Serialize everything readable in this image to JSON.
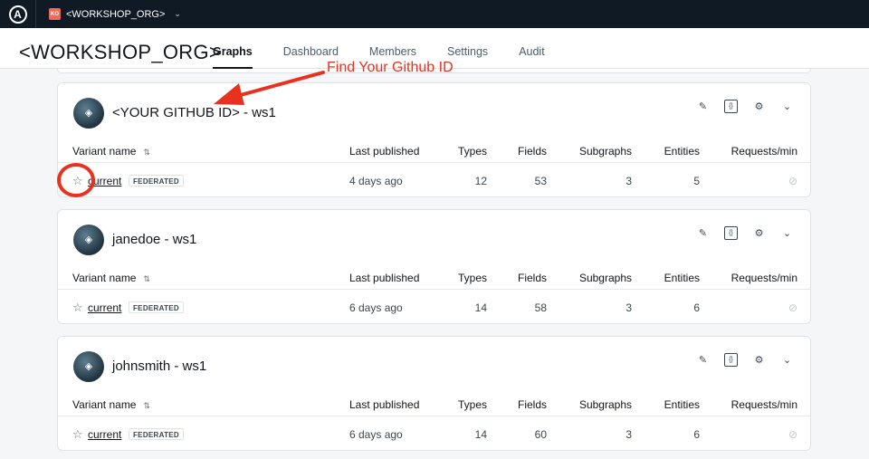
{
  "topbar": {
    "logo_letter": "A",
    "org_badge": "KO",
    "org_name": "<WORKSHOP_ORG>",
    "chevron": "⌄"
  },
  "header": {
    "title": "<WORKSHOP_ORG>",
    "tabs": [
      {
        "label": "Graphs",
        "active": true
      },
      {
        "label": "Dashboard",
        "active": false
      },
      {
        "label": "Members",
        "active": false
      },
      {
        "label": "Settings",
        "active": false
      },
      {
        "label": "Audit",
        "active": false
      }
    ]
  },
  "table_headers": {
    "variant": "Variant name",
    "last_published": "Last published",
    "types": "Types",
    "fields": "Fields",
    "subgraphs": "Subgraphs",
    "entities": "Entities",
    "requests": "Requests/min"
  },
  "cards": [
    {
      "title": "<YOUR GITHUB ID> - ws1",
      "row": {
        "variant": "current",
        "badge": "FEDERATED",
        "last_published": "4 days ago",
        "types": "12",
        "fields": "53",
        "subgraphs": "3",
        "entities": "5"
      }
    },
    {
      "title": "janedoe - ws1",
      "row": {
        "variant": "current",
        "badge": "FEDERATED",
        "last_published": "6 days ago",
        "types": "14",
        "fields": "58",
        "subgraphs": "3",
        "entities": "6"
      }
    },
    {
      "title": "johnsmith - ws1",
      "row": {
        "variant": "current",
        "badge": "FEDERATED",
        "last_published": "6 days ago",
        "types": "14",
        "fields": "60",
        "subgraphs": "3",
        "entities": "6"
      }
    }
  ],
  "icons": {
    "star": "☆",
    "sort": "⇅",
    "edit": "✎",
    "code": "{}",
    "gear": "⚙",
    "chevron": "⌄",
    "disabled": "⊘",
    "graph_mark": "◈"
  },
  "annotation": {
    "text": "Find Your Github ID",
    "color": "#e8321f"
  }
}
